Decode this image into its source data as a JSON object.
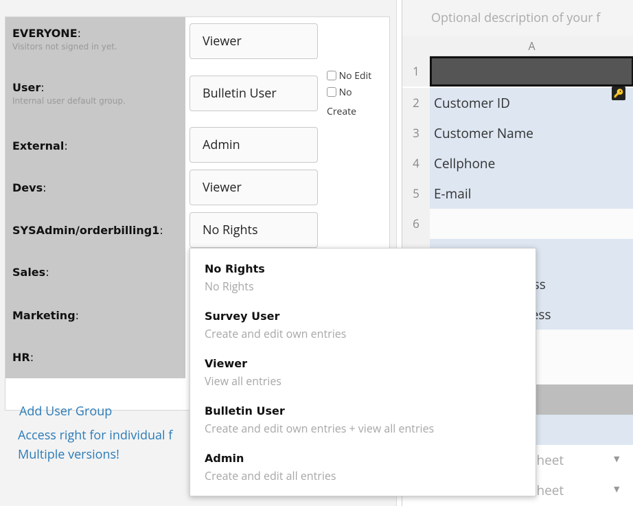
{
  "groups": [
    {
      "name": "EVERYONE",
      "desc": "Visitors not signed in yet.",
      "role": "Viewer"
    },
    {
      "name": "User",
      "desc": "Internal user default group.",
      "role": "Bulletin User"
    },
    {
      "name": "External",
      "desc": "",
      "role": "Admin"
    },
    {
      "name": "Devs",
      "desc": "",
      "role": "Viewer"
    },
    {
      "name": "SYSAdmin/orderbilling1",
      "desc": "",
      "role": "No Rights"
    },
    {
      "name": "Sales",
      "desc": "",
      "role": ""
    },
    {
      "name": "Marketing",
      "desc": "",
      "role": ""
    },
    {
      "name": "HR",
      "desc": "",
      "role": ""
    }
  ],
  "colon": ":",
  "options_checkboxes": {
    "no_edit": "No Edit",
    "no": "No",
    "create": "Create"
  },
  "add_group_label": "Add User Group",
  "access_text_line1": "Access right for individual f",
  "access_text_line2": "Multiple versions!",
  "sheet": {
    "description_placeholder": "Optional description of your f",
    "column": "A",
    "rows": [
      {
        "num": "1",
        "value": ""
      },
      {
        "num": "2",
        "value": "Customer ID"
      },
      {
        "num": "3",
        "value": "Customer Name"
      },
      {
        "num": "4",
        "value": "Cellphone"
      },
      {
        "num": "5",
        "value": "E-mail"
      },
      {
        "num": "6",
        "value": ""
      },
      {
        "num": "",
        "value": ""
      },
      {
        "num": "",
        "value": "ess"
      },
      {
        "num": "",
        "value": "ress"
      }
    ],
    "sheet_selector_1": "ner Sheet",
    "sheet_selector_2": "ner Sheet",
    "key_icon": "key-icon"
  },
  "dropdown": {
    "options": [
      {
        "title": "No Rights",
        "desc": "No Rights"
      },
      {
        "title": "Survey User",
        "desc": "Create and edit own entries"
      },
      {
        "title": "Viewer",
        "desc": "View all entries"
      },
      {
        "title": "Bulletin User",
        "desc": "Create and edit own entries + view all entries"
      },
      {
        "title": "Admin",
        "desc": "Create and edit all entries"
      }
    ]
  }
}
